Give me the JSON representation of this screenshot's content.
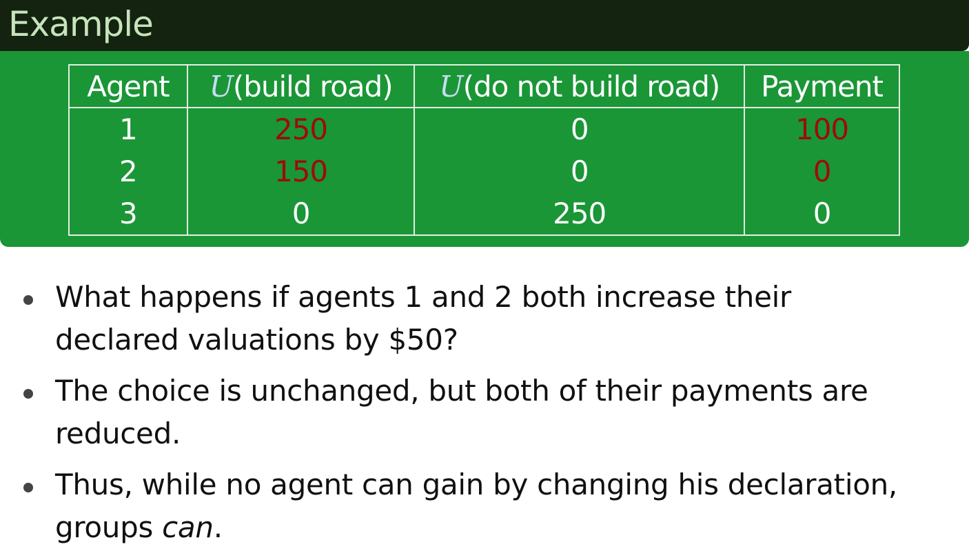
{
  "slide": {
    "title": "Example"
  },
  "table": {
    "headers": {
      "agent": "Agent",
      "u_build_symbol": "U",
      "u_build_text": "(build road)",
      "u_nobuild_symbol": "U",
      "u_nobuild_text": "(do not build road)",
      "payment": "Payment"
    },
    "rows": [
      {
        "agent": "1",
        "u_build": "250",
        "u_no_build": "0",
        "payment": "100"
      },
      {
        "agent": "2",
        "u_build": "150",
        "u_no_build": "0",
        "payment": "0"
      },
      {
        "agent": "3",
        "u_build": "0",
        "u_no_build": "250",
        "payment": "0"
      }
    ]
  },
  "bullets": [
    "What happens if agents 1 and 2 both increase their declared valuations by $50?",
    "The choice is unchanged, but both of their payments are reduced.",
    {
      "before": "Thus, while no agent can gain by changing his declaration, groups ",
      "emphasis": "can",
      "after": "."
    }
  ],
  "colors": {
    "title_bar": "#14230f",
    "title_text": "#c6e4bc",
    "table_block": "#1a9636",
    "highlight_red": "#9d0b0b",
    "math_symbol": "#c6dcf3"
  }
}
